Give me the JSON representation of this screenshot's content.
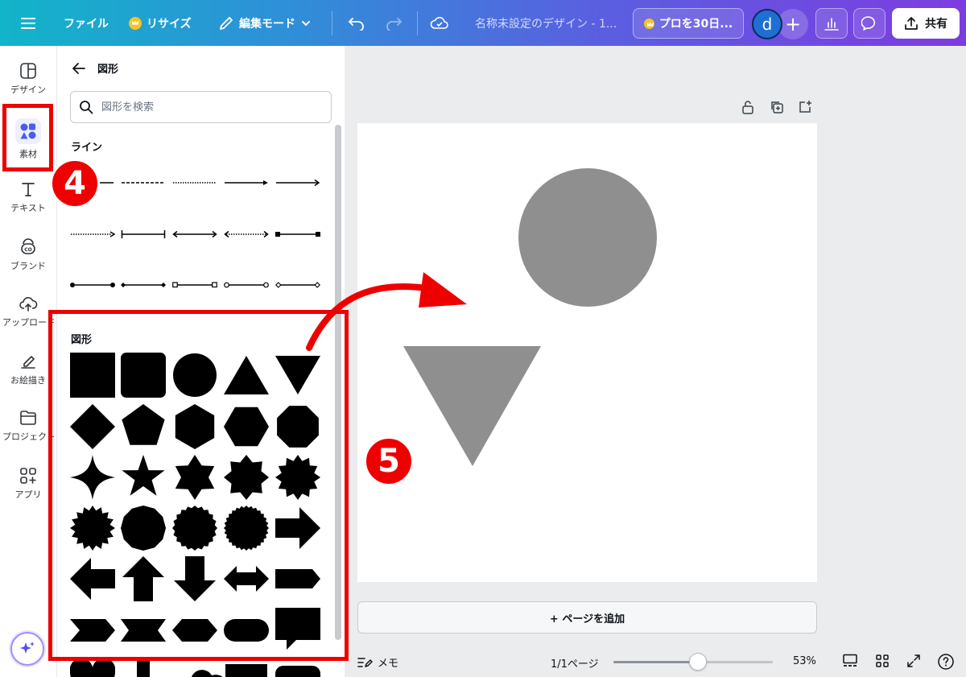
{
  "topbar": {
    "menu_icon": "hamburger-icon",
    "file_label": "ファイル",
    "resize_label": "リサイズ",
    "edit_mode_label": "編集モード",
    "doc_title": "名称未設定のデザイン - 1...",
    "pro_label": "プロを30日...",
    "avatar_letter": "d",
    "share_label": "共有"
  },
  "rail": {
    "items": [
      {
        "label": "デザイン",
        "icon": "layout-icon"
      },
      {
        "label": "素材",
        "icon": "elements-icon"
      },
      {
        "label": "テキスト",
        "icon": "text-icon"
      },
      {
        "label": "ブランド",
        "icon": "brand-icon"
      },
      {
        "label": "アップロード",
        "icon": "upload-cloud-icon"
      },
      {
        "label": "お絵描き",
        "icon": "draw-icon"
      },
      {
        "label": "プロジェクト",
        "icon": "folder-icon"
      },
      {
        "label": "アプリ",
        "icon": "apps-icon"
      }
    ],
    "active_index": 1
  },
  "panel": {
    "title": "図形",
    "search_placeholder": "図形を検索",
    "lines_heading": "ライン",
    "shapes_heading": "図形"
  },
  "canvas": {
    "add_page_label": "+ ページを追加",
    "shape_color": "#8f8f8f"
  },
  "bottombar": {
    "notes_label": "メモ",
    "page_indicator": "1/1ページ",
    "zoom_value": 0.53,
    "zoom_label": "53%"
  },
  "annotations": {
    "step4": "4",
    "step5": "5",
    "color": "#ef0000"
  }
}
